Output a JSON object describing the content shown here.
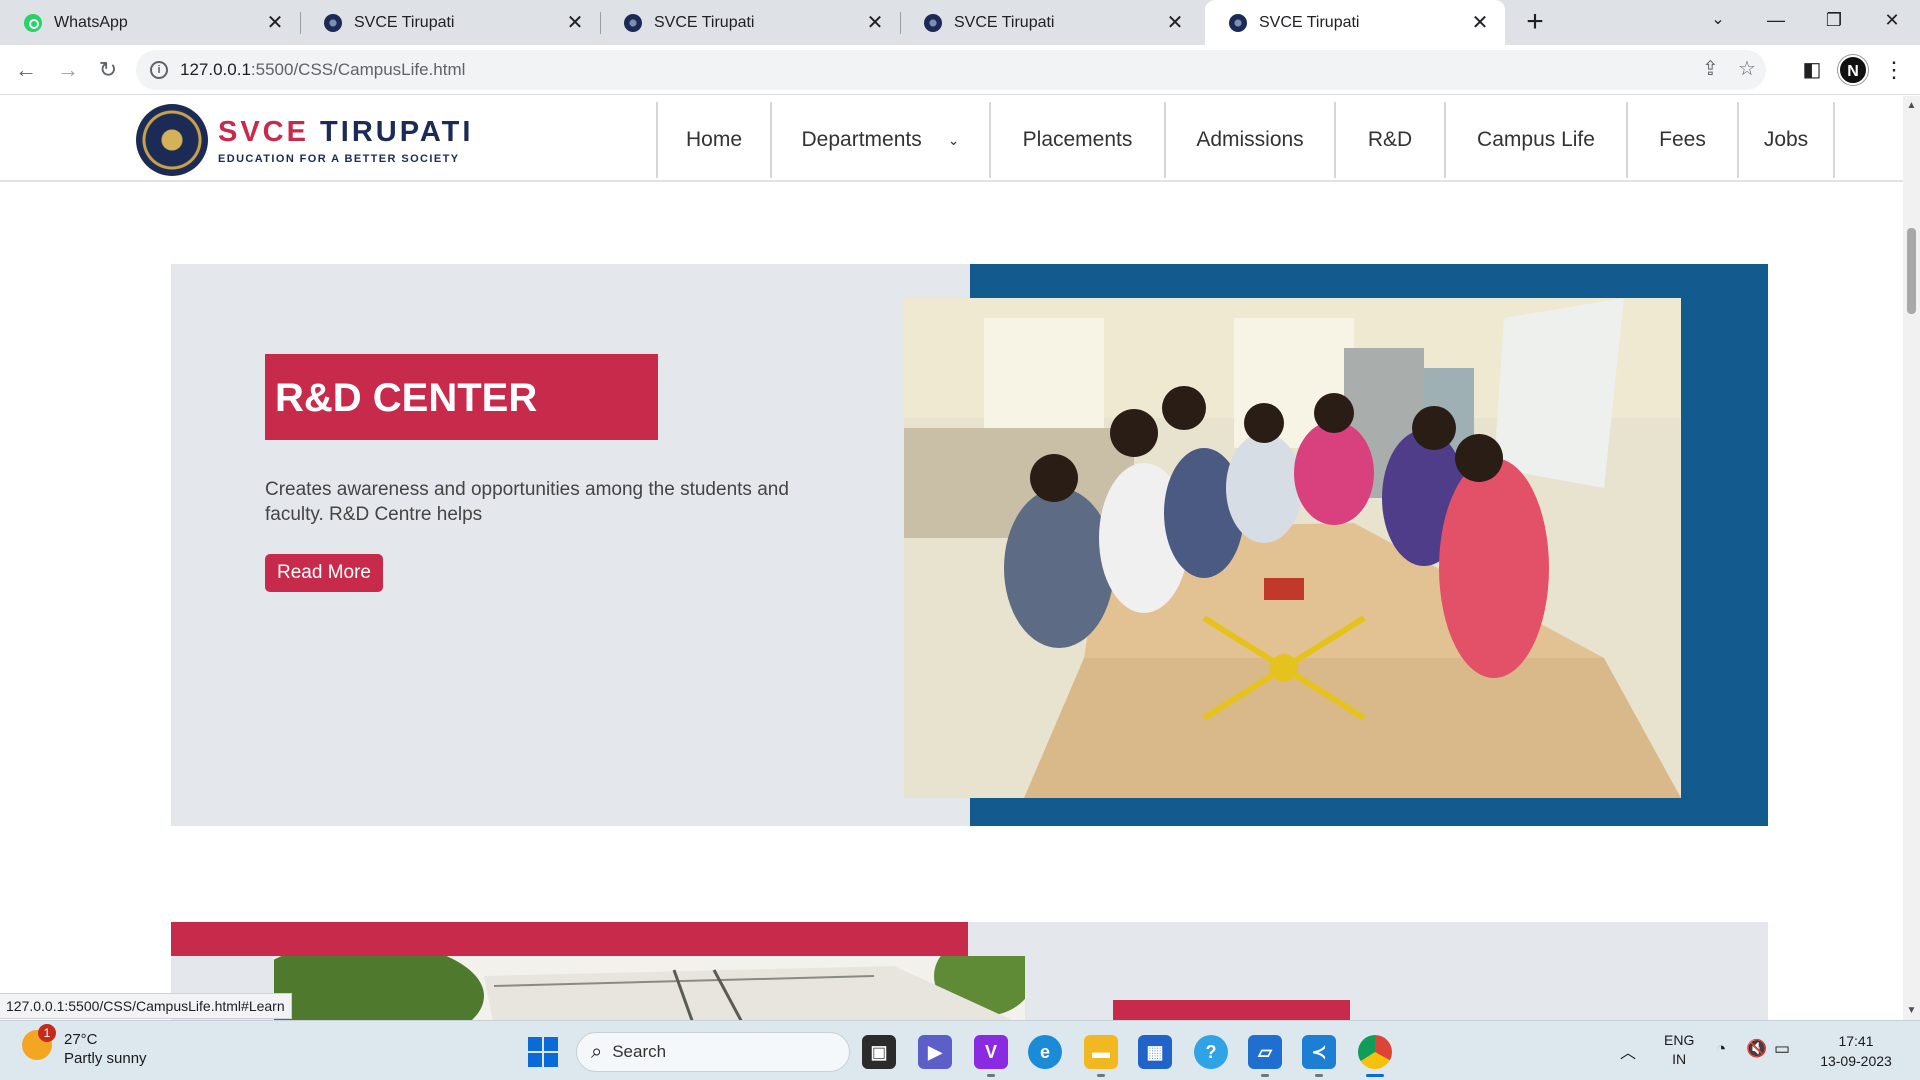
{
  "browser": {
    "tabs": [
      {
        "title": "WhatsApp",
        "icon": "whatsapp-icon",
        "active": false
      },
      {
        "title": "SVCE Tirupati",
        "icon": "svce-favicon",
        "active": false
      },
      {
        "title": "SVCE Tirupati",
        "icon": "svce-favicon",
        "active": false
      },
      {
        "title": "SVCE Tirupati",
        "icon": "svce-favicon",
        "active": false
      },
      {
        "title": "SVCE Tirupati",
        "icon": "svce-favicon",
        "active": true
      }
    ],
    "address": {
      "host": "127.0.0.1",
      "path": ":5500/CSS/CampusLife.html"
    },
    "profile_initial": "N",
    "status_url": "127.0.0.1:5500/CSS/CampusLife.html#Learn"
  },
  "site": {
    "logo": {
      "name_part1": "SVCE",
      "name_part2": "TIRUPATI",
      "tagline": "EDUCATION FOR A BETTER SOCIETY"
    },
    "menu": [
      "Home",
      "Departments",
      "Placements",
      "Admissions",
      "R&D",
      "Campus Life",
      "Fees",
      "Jobs"
    ]
  },
  "section": {
    "label": "R&D CENTER",
    "description": "Creates awareness and opportunities among the students and faculty. R&D Centre helps",
    "button": "Read More"
  },
  "taskbar": {
    "weather": {
      "temp": "27°C",
      "condition": "Partly sunny",
      "badge": "1"
    },
    "search_label": "Search",
    "lang": {
      "line1": "ENG",
      "line2": "IN"
    },
    "time": "17:41",
    "date": "13-09-2023"
  },
  "colors": {
    "brand_red": "#c82a4b",
    "brand_blue": "#135b8f",
    "navy": "#1b2b55",
    "card_gray": "#e4e8ec"
  }
}
